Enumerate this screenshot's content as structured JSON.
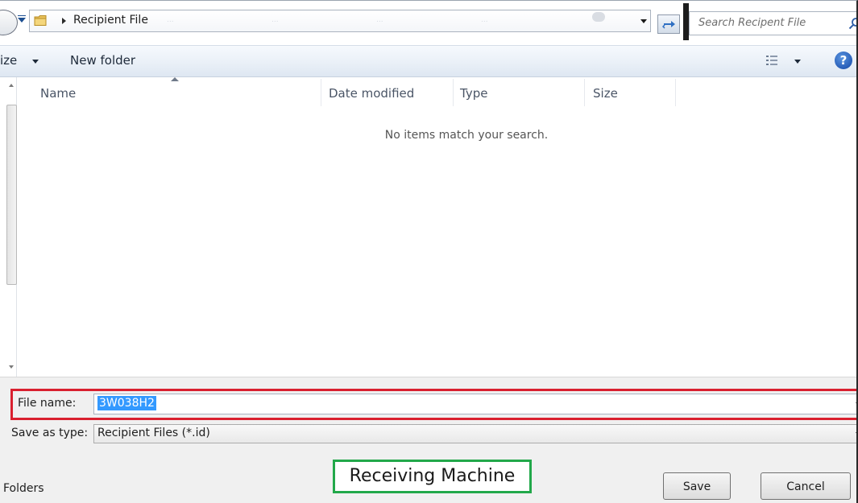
{
  "addressbar": {
    "path_label": "Recipient File",
    "ghost_fragments": [
      "...",
      "...",
      "...",
      "..."
    ]
  },
  "search": {
    "placeholder": "Search Recipent File"
  },
  "toolbar": {
    "organize_label": "ize",
    "new_folder_label": "New folder",
    "help_label": "?"
  },
  "filelist": {
    "columns": [
      {
        "label": "Name"
      },
      {
        "label": "Date modified"
      },
      {
        "label": "Type"
      },
      {
        "label": "Size"
      }
    ],
    "empty_message": "No items match your search."
  },
  "form": {
    "file_name_label": "File name:",
    "file_name_value": "3W038H2",
    "save_as_type_label": "Save as type:",
    "save_as_type_value": "Recipient Files (*.id)"
  },
  "annotation": {
    "label": "Receiving Machine",
    "highlight_color": "#d9202f",
    "label_border_color": "#22a84a"
  },
  "footer": {
    "hide_folders_label": "Folders"
  },
  "buttons": {
    "save_label": "Save",
    "cancel_label": "Cancel"
  },
  "icons": {
    "nav": "back-forward-circle-icon",
    "folder": "folder-icon",
    "refresh": "refresh-icon",
    "search": "search-icon",
    "views": "views-icon",
    "help": "help-icon"
  }
}
